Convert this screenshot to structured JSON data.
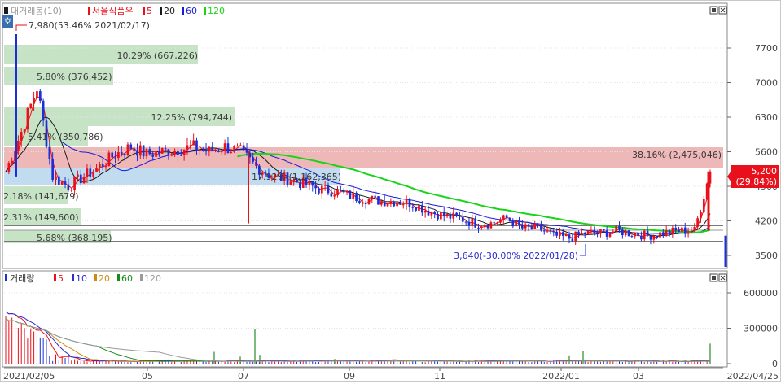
{
  "price_panel": {
    "legend_prefix": "대거래봉(10)",
    "stock_name": "서울식품우",
    "ma_periods": [
      "5",
      "20",
      "60",
      "120"
    ],
    "ma_colors": [
      "#e8101a",
      "#1a1a1a",
      "#1a1ad8",
      "#19d419"
    ]
  },
  "volume_panel": {
    "title": "거래량",
    "ma_periods": [
      "5",
      "10",
      "20",
      "60",
      "120"
    ],
    "ma_colors": [
      "#e8101a",
      "#2b2bd0",
      "#d08a10",
      "#1a8a1a",
      "#9a9a9a"
    ]
  },
  "side_button": "호",
  "current_price_tag": {
    "price": "5,200",
    "change": "(29.84%)"
  },
  "annotations": {
    "high": "7,980(53.46% 2021/02/17)",
    "low": "3,640(-30.00% 2022/01/28)"
  },
  "volume_profile": [
    {
      "label": "10.29% (667,226)"
    },
    {
      "label": "5.80% (376,452)"
    },
    {
      "label": "12.25% (794,744)"
    },
    {
      "label": "5.41% (350,786)"
    },
    {
      "label": "38.16% (2,475,046)"
    },
    {
      "label": "17.92% (1,162,365)"
    },
    {
      "label": "2.18% (141,679)"
    },
    {
      "label": "2.31% (149,600)"
    },
    {
      "label": "5.68% (368,195)"
    }
  ],
  "x_axis_labels": [
    "2021/02/05",
    "05",
    "07",
    "09",
    "11",
    "2022/01",
    "03",
    "2022/04/25"
  ],
  "chart_data": [
    {
      "type": "candlestick",
      "x": [
        "2021/02/05",
        "2021/02/10",
        "2021/02/17",
        "2021/02/24",
        "2021/03/05",
        "2021/03/15",
        "2021/03/25",
        "2021/04/05",
        "2021/04/15",
        "2021/04/25",
        "2021/05/05",
        "2021/05/15",
        "2021/05/25",
        "2021/06/05",
        "2021/06/15",
        "2021/06/25",
        "2021/07/05",
        "2021/07/15",
        "2021/07/25",
        "2021/08/05",
        "2021/08/15",
        "2021/08/25",
        "2021/09/05",
        "2021/09/15",
        "2021/09/25",
        "2021/10/05",
        "2021/10/15",
        "2021/10/25",
        "2021/11/05",
        "2021/11/15",
        "2021/11/25",
        "2021/12/05",
        "2021/12/15",
        "2021/12/25",
        "2022/01/05",
        "2022/01/15",
        "2022/01/28",
        "2022/02/05",
        "2022/02/15",
        "2022/02/25",
        "2022/03/05",
        "2022/03/15",
        "2022/03/25",
        "2022/04/05",
        "2022/04/15",
        "2022/04/25"
      ],
      "close": [
        5200,
        6000,
        6900,
        5100,
        4900,
        5100,
        5300,
        5550,
        5700,
        5550,
        5600,
        5650,
        5700,
        5600,
        5700,
        5600,
        5300,
        5100,
        5050,
        4950,
        4850,
        4800,
        4700,
        4650,
        4600,
        4600,
        4550,
        4400,
        4300,
        4250,
        4150,
        4150,
        4250,
        4050,
        4050,
        3900,
        3850,
        3950,
        3950,
        4000,
        3950,
        3900,
        3950,
        4000,
        4000,
        5200
      ],
      "y_axis_ticks": [
        7700,
        7000,
        6300,
        5600,
        4900,
        4200,
        3500
      ],
      "ma_series_names": [
        "5",
        "20",
        "60",
        "120"
      ],
      "max_label": "7,980(53.46% 2021/02/17)",
      "min_label": "3,640(-30.00% 2022/01/28)"
    },
    {
      "type": "bar",
      "title": "거래량",
      "y_axis_ticks": [
        600000,
        300000,
        0
      ],
      "ma_series_names": [
        "5",
        "10",
        "20",
        "60",
        "120"
      ]
    }
  ]
}
